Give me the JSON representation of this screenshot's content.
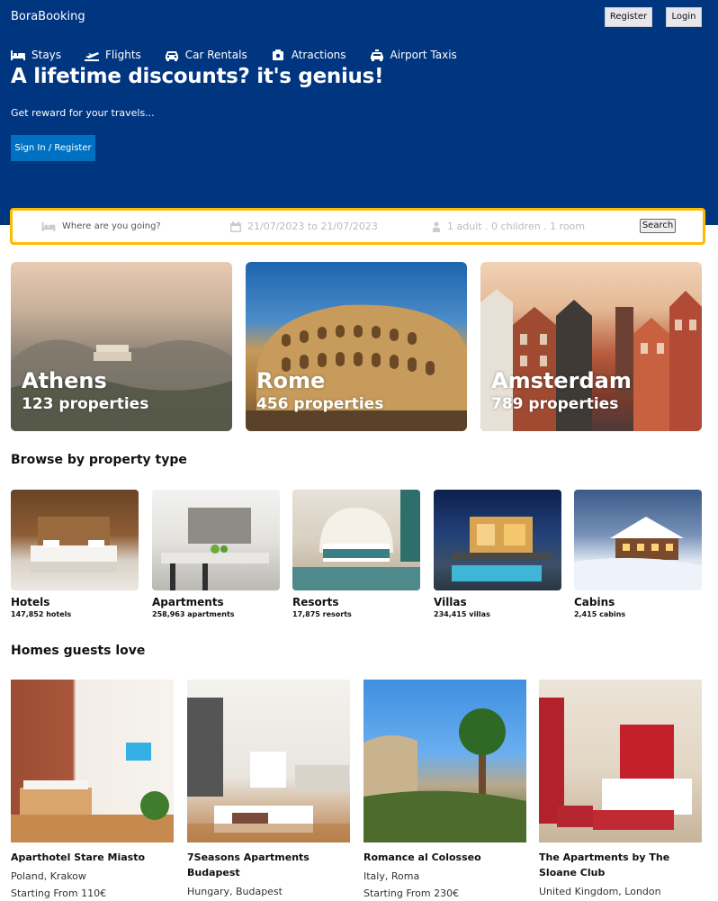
{
  "header": {
    "logo": "BoraBooking",
    "register_label": "Register",
    "login_label": "Login",
    "nav": [
      {
        "label": "Stays",
        "icon": "bed-icon"
      },
      {
        "label": "Flights",
        "icon": "plane-icon"
      },
      {
        "label": "Car Rentals",
        "icon": "car-icon"
      },
      {
        "label": "Atractions",
        "icon": "taxi-icon"
      },
      {
        "label": "Airport Taxis",
        "icon": "taxi-icon"
      }
    ],
    "title": "A lifetime discounts? it's genius!",
    "subtitle": "Get reward for your travels...",
    "signin_label": "Sign In / Register"
  },
  "search": {
    "destination_placeholder": "Where are you going?",
    "dates": "21/07/2023 to 21/07/2023",
    "guests": "1 adult . 0 children . 1 room",
    "button": "Search"
  },
  "cities": [
    {
      "name": "Athens",
      "properties": "123 properties"
    },
    {
      "name": "Rome",
      "properties": "456 properties"
    },
    {
      "name": "Amsterdam",
      "properties": "789 properties"
    }
  ],
  "property_types": {
    "title": "Browse by property type",
    "items": [
      {
        "name": "Hotels",
        "count": "147,852 hotels"
      },
      {
        "name": "Apartments",
        "count": "258,963 apartments"
      },
      {
        "name": "Resorts",
        "count": "17,875 resorts"
      },
      {
        "name": "Villas",
        "count": "234,415 villas"
      },
      {
        "name": "Cabins",
        "count": "2,415 cabins"
      }
    ]
  },
  "homes": {
    "title": "Homes guests love",
    "items": [
      {
        "name": "Aparthotel Stare Miasto",
        "location": "Poland, Krakow",
        "price": "Starting From 110€"
      },
      {
        "name": "7Seasons Apartments Budapest",
        "location": "Hungary, Budapest",
        "price": ""
      },
      {
        "name": "Romance al Colosseo",
        "location": "Italy, Roma",
        "price": "Starting From 230€"
      },
      {
        "name": "The Apartments by The Sloane Club",
        "location": "United Kingdom, London",
        "price": ""
      }
    ]
  },
  "colors": {
    "header_bg": "#003580",
    "primary_button": "#0071c2",
    "search_border": "#febb02"
  }
}
